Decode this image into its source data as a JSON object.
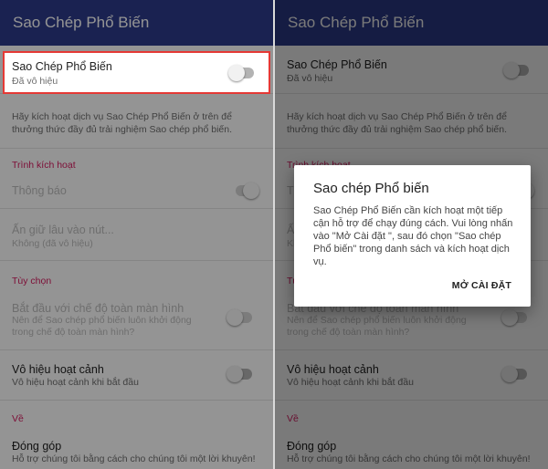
{
  "app": {
    "title": "Sao Chép Phổ Biến"
  },
  "settings": {
    "service": {
      "title": "Sao Chép Phổ Biến",
      "status": "Đã vô hiệu"
    },
    "description": "Hãy kích hoạt dịch vụ Sao Chép Phổ Biến ở trên để thưởng thức đầy đủ trải nghiệm Sao chép phổ biến.",
    "section_trigger": "Trình kích hoạt",
    "notification": {
      "title": "Thông báo"
    },
    "long_press": {
      "title": "Ấn giữ lâu vào nút...",
      "value": "Không (đã vô hiệu)"
    },
    "section_options": "Tùy chọn",
    "fullscreen": {
      "title": "Bắt đầu với chế độ toàn màn hình",
      "subtitle": "Nên để Sao chép phổ biến luôn khởi động trong chế độ toàn màn hình?"
    },
    "disable_scene": {
      "title": "Vô hiệu hoạt cảnh",
      "subtitle": "Vô hiệu hoạt cảnh khi bắt đầu"
    },
    "section_about": "Về",
    "contribute": {
      "title": "Đóng góp",
      "subtitle": "Hỗ trợ chúng tôi bằng cách cho chúng tôi một lời khuyên!"
    }
  },
  "dialog": {
    "title": "Sao chép Phổ biến",
    "message": "Sao Chép Phổ Biến cần kích hoạt một tiếp cận hỗ trợ để chạy đúng cách. Vui lòng nhấn vào \"Mở Cài đặt \", sau đó chọn \"Sao chép Phổ biến\" trong danh sách và kích hoạt dịch vụ.",
    "button": "MỞ CÀI ĐẶT"
  },
  "colors": {
    "appbar": "#2d3b8c",
    "section": "#d81b60",
    "highlight_border": "#e53935"
  }
}
